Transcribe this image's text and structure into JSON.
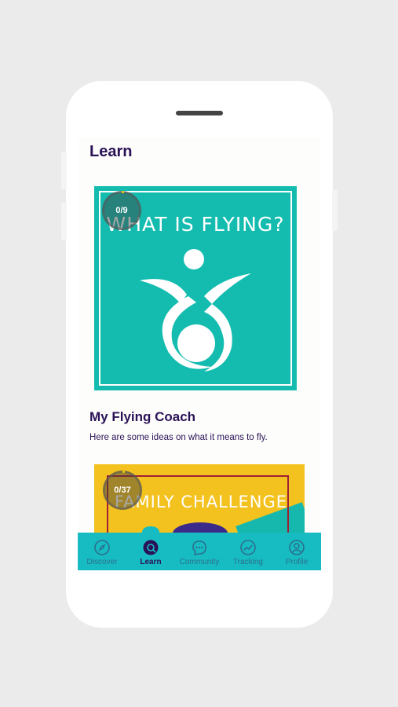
{
  "screen": {
    "title": "Learn"
  },
  "courses": [
    {
      "image_title": "WHAT IS FLYING?",
      "progress": "0/9",
      "title": "My Flying Coach",
      "description": "Here are some ideas on what it means to fly."
    },
    {
      "image_title": "FAMILY CHALLENGE",
      "progress": "0/37"
    }
  ],
  "tabs": [
    {
      "label": "Discover",
      "icon": "compass-icon"
    },
    {
      "label": "Learn",
      "icon": "learn-icon",
      "active": true
    },
    {
      "label": "Community",
      "icon": "chat-icon"
    },
    {
      "label": "Tracking",
      "icon": "chart-icon"
    },
    {
      "label": "Profile",
      "icon": "profile-icon"
    }
  ],
  "colors": {
    "background": "#ebebeb",
    "primary_text": "#2a1257",
    "teal": "#14bcb0",
    "tabbar": "#16bcc2",
    "yellow": "#f3c21f"
  }
}
